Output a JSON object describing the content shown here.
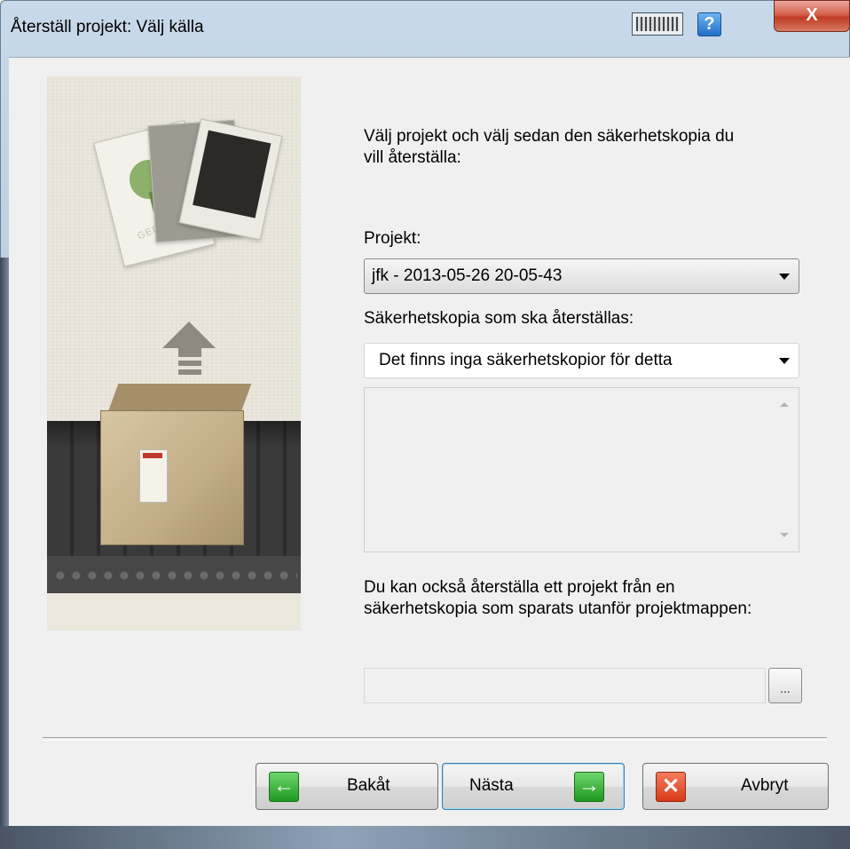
{
  "window": {
    "title": "Återställ projekt: Välj källa",
    "help_label": "?",
    "close_label": "X"
  },
  "illustration": {
    "card_text": "GEDCOM"
  },
  "main": {
    "intro": "Välj projekt och välj sedan den säkerhetskopia du vill återställa:",
    "project_label": "Projekt:",
    "project_value": "jfk - 2013-05-26 20-05-43",
    "backup_label": "Säkerhetskopia som ska återställas:",
    "backup_value": "Det finns inga säkerhetskopior för detta",
    "external_text": "Du kan också återställa ett projekt från en säkerhetskopia som sparats utanför projektmappen:",
    "browse_label": "..."
  },
  "buttons": {
    "back_label": "Bakåt",
    "next_label": "Nästa",
    "cancel_label": "Avbryt"
  }
}
